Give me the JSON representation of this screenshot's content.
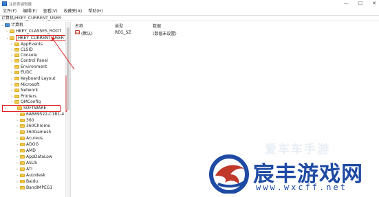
{
  "window": {
    "title": "注册表编辑器",
    "controls": [
      "—",
      "☐",
      "✕"
    ]
  },
  "menu": [
    "文件(F)",
    "编辑(E)",
    "查看(V)",
    "收藏夹(A)",
    "帮助(H)"
  ],
  "address": "计算机\\HKEY_CURRENT_USER",
  "tree": {
    "root": "计算机",
    "hives": [
      "HKEY_CLASSES_ROOT",
      "HKEY_CURRENT_USER"
    ],
    "hkcu_children": [
      "AppEvents",
      "CLSID",
      "Console",
      "Control Panel",
      "Environment",
      "EUDC",
      "Keyboard Layout",
      "Microsoft",
      "Network",
      "Printers",
      "QMConfig",
      "SOFTWARE"
    ],
    "software_children": [
      "6AB89522-C1B1-4",
      "360",
      "360Chrome",
      "360Games5",
      "Acureus",
      "ADOG",
      "AMD",
      "AppDataLow",
      "ASUS",
      "ATI",
      "Autodesk",
      "Baidu",
      "BandIMPEG1"
    ]
  },
  "list": {
    "columns": [
      "名称",
      "类型",
      "数据"
    ],
    "rows": [
      {
        "name": "(默认)",
        "type": "REG_SZ",
        "data": "(数值未设置)"
      }
    ]
  },
  "watermark": {
    "faint": "爱车车手游",
    "brand": "宸丰游戏网",
    "url": "www.wxcff.net"
  },
  "colors": {
    "highlight": "#e02020",
    "brand": "#1e4aa3",
    "folder": "#f2c94c"
  }
}
